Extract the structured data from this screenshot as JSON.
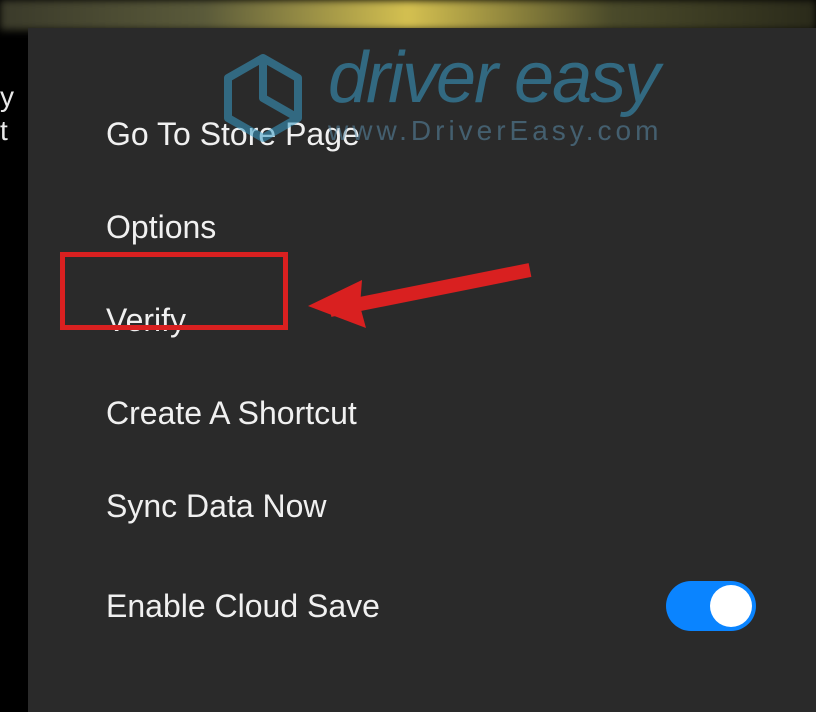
{
  "side_text": {
    "line1": "y",
    "line2": "t"
  },
  "watermark": {
    "brand": "driver easy",
    "url": "www.DriverEasy.com"
  },
  "menu": {
    "items": [
      {
        "label": "Go To Store Page",
        "has_toggle": false
      },
      {
        "label": "Options",
        "has_toggle": false
      },
      {
        "label": "Verify",
        "has_toggle": false
      },
      {
        "label": "Create A Shortcut",
        "has_toggle": false
      },
      {
        "label": "Sync Data Now",
        "has_toggle": false
      },
      {
        "label": "Enable Cloud Save",
        "has_toggle": true
      }
    ]
  },
  "highlight": {
    "target_label": "Verify"
  },
  "colors": {
    "highlight_border": "#d92020",
    "arrow": "#d92020",
    "toggle_on": "#0a84ff",
    "menu_bg": "#2a2a2a",
    "text": "#f0f0f0",
    "watermark": "#3a9ec8"
  }
}
